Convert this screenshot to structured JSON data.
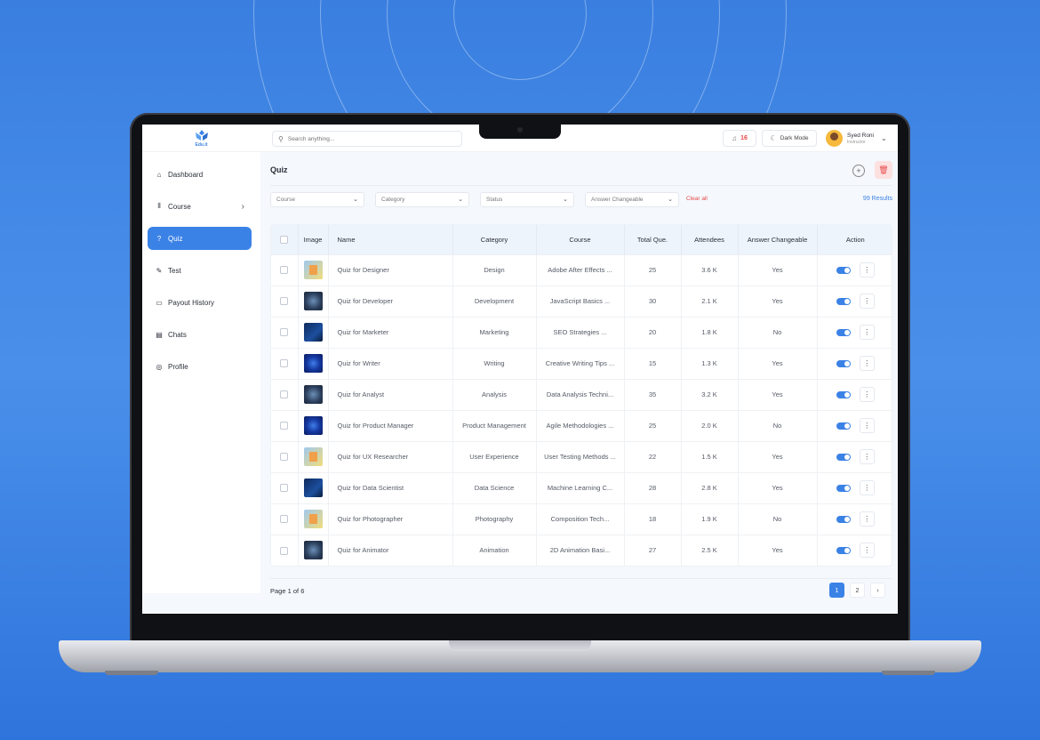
{
  "app": {
    "logo_text": "Edu.it"
  },
  "search": {
    "placeholder": "Search anything..."
  },
  "header": {
    "notification_count": "16",
    "dark_mode_label": "Dark Mode",
    "user_name": "Syed Roni",
    "user_role": "Instructor"
  },
  "sidebar": {
    "items": [
      {
        "label": "Dashboard",
        "icon": "home-icon"
      },
      {
        "label": "Course",
        "icon": "books-icon"
      },
      {
        "label": "Quiz",
        "icon": "question-icon",
        "active": true
      },
      {
        "label": "Test",
        "icon": "test-icon"
      },
      {
        "label": "Payout History",
        "icon": "payout-icon"
      },
      {
        "label": "Chats",
        "icon": "chat-icon"
      },
      {
        "label": "Profile",
        "icon": "profile-icon"
      }
    ]
  },
  "page": {
    "title": "Quiz"
  },
  "filters": {
    "course": "Course",
    "category": "Category",
    "status": "Status",
    "answer_changeable": "Answer Changeable",
    "clear_all": "Clear all",
    "results": "99 Results"
  },
  "table": {
    "headers": [
      "Image",
      "Name",
      "Category",
      "Course",
      "Total Que.",
      "Attendees",
      "Answer Changeable",
      "Action"
    ],
    "rows": [
      {
        "name": "Quiz for Designer",
        "category": "Design",
        "course": "Adobe After Effects ...",
        "total": "25",
        "attendees": "3.6 K",
        "changeable": "Yes",
        "thumb": "t1"
      },
      {
        "name": "Quiz for Developer",
        "category": "Development",
        "course": "JavaScript Basics ...",
        "total": "30",
        "attendees": "2.1 K",
        "changeable": "Yes",
        "thumb": "t2"
      },
      {
        "name": "Quiz for Marketer",
        "category": "Marketing",
        "course": "SEO Strategies ...",
        "total": "20",
        "attendees": "1.8 K",
        "changeable": "No",
        "thumb": "t3"
      },
      {
        "name": "Quiz for Writer",
        "category": "Writing",
        "course": "Creative Writing Tips ...",
        "total": "15",
        "attendees": "1.3 K",
        "changeable": "Yes",
        "thumb": "t4"
      },
      {
        "name": "Quiz for Analyst",
        "category": "Analysis",
        "course": "Data Analysis Techni...",
        "total": "35",
        "attendees": "3.2 K",
        "changeable": "Yes",
        "thumb": "t2"
      },
      {
        "name": "Quiz for Product Manager",
        "category": "Product Management",
        "course": "Agile Methodologies ...",
        "total": "25",
        "attendees": "2.0 K",
        "changeable": "No",
        "thumb": "t4"
      },
      {
        "name": "Quiz for UX Researcher",
        "category": "User Experience",
        "course": "User Testing Methods ...",
        "total": "22",
        "attendees": "1.5 K",
        "changeable": "Yes",
        "thumb": "t1"
      },
      {
        "name": "Quiz for Data Scientist",
        "category": "Data Science",
        "course": "Machine Learning C...",
        "total": "28",
        "attendees": "2.8 K",
        "changeable": "Yes",
        "thumb": "t3"
      },
      {
        "name": "Quiz for Photographer",
        "category": "Photography",
        "course": "Composition Tech...",
        "total": "18",
        "attendees": "1.9 K",
        "changeable": "No",
        "thumb": "t1"
      },
      {
        "name": "Quiz for Animator",
        "category": "Animation",
        "course": "2D Animation Basi...",
        "total": "27",
        "attendees": "2.5 K",
        "changeable": "Yes",
        "thumb": "t2"
      }
    ]
  },
  "pagination": {
    "info": "Page 1 of 6",
    "pages": [
      "1",
      "2"
    ],
    "current": "1"
  },
  "colors": {
    "accent": "#3b82e6",
    "danger": "#e74a4a",
    "background": "#3a7fe0"
  }
}
